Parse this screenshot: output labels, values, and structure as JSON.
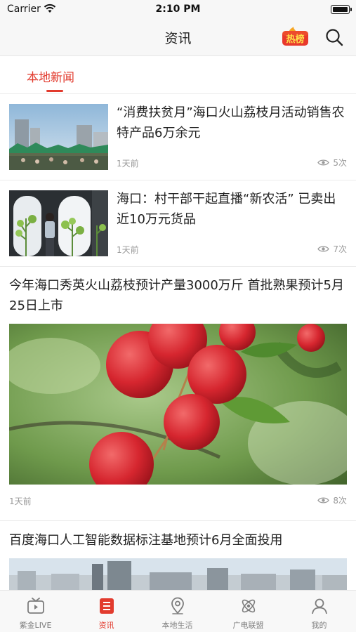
{
  "status_bar": {
    "carrier": "Carrier",
    "time": "2:10 PM"
  },
  "header": {
    "title": "资讯",
    "hot_badge_text": "热榜",
    "search_icon": "search-icon"
  },
  "tabs": [
    {
      "label": "本地新闻",
      "active": true
    }
  ],
  "news": [
    {
      "title": "“消费扶贫月”海口火山荔枝月活动销售农特产品6万余元",
      "time": "1天前",
      "views": "5次",
      "layout": "small"
    },
    {
      "title": "海口：村干部干起直播“新农活” 已卖出近10万元货品",
      "time": "1天前",
      "views": "7次",
      "layout": "small"
    },
    {
      "title": "今年海口秀英火山荔枝预计产量3000万斤 首批熟果预计5月25日上市",
      "time": "1天前",
      "views": "8次",
      "layout": "big"
    },
    {
      "title": "百度海口人工智能数据标注基地预计6月全面投用",
      "layout": "big"
    }
  ],
  "bottom_tabs": [
    {
      "label": "紫金LIVE",
      "icon": "tv-icon",
      "active": false
    },
    {
      "label": "资讯",
      "icon": "news-list-icon",
      "active": true
    },
    {
      "label": "本地生活",
      "icon": "location-pin-icon",
      "active": false
    },
    {
      "label": "广电联盟",
      "icon": "atom-icon",
      "active": false
    },
    {
      "label": "我的",
      "icon": "user-icon",
      "active": false
    }
  ],
  "colors": {
    "accent": "#e23b2e",
    "muted_text": "#9a9a9a",
    "bar_bg": "#f7f7f7"
  }
}
